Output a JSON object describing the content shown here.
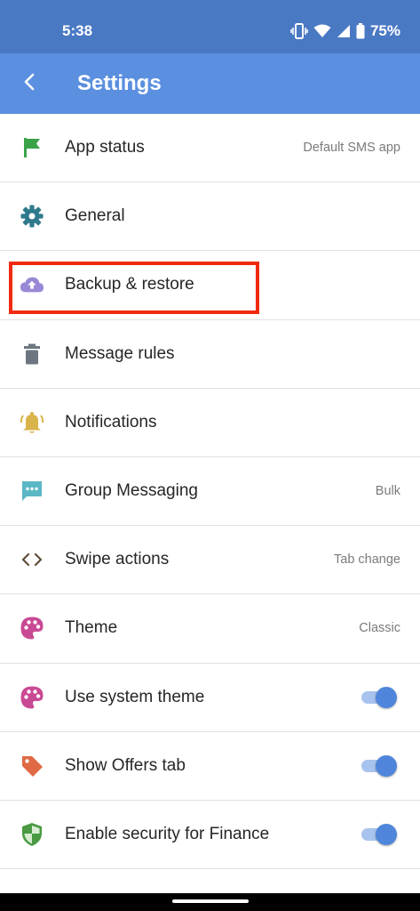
{
  "status_bar": {
    "time": "5:38",
    "battery": "75%",
    "icons": [
      "vibrate-icon",
      "wifi-icon",
      "signal-icon",
      "battery-icon"
    ]
  },
  "app_bar": {
    "title": "Settings",
    "back_icon": "chevron-left-icon"
  },
  "settings": {
    "items": [
      {
        "label": "App status",
        "value": "Default SMS app",
        "icon": "flag-icon",
        "icon_color": "#3aa34a"
      },
      {
        "label": "General",
        "value": "",
        "icon": "gear-icon",
        "icon_color": "#2e7a8c"
      },
      {
        "label": "Backup & restore",
        "value": "",
        "icon": "cloud-upload-icon",
        "icon_color": "#9a88d6"
      },
      {
        "label": "Message rules",
        "value": "",
        "icon": "trash-icon",
        "icon_color": "#6c7681"
      },
      {
        "label": "Notifications",
        "value": "",
        "icon": "bell-icon",
        "icon_color": "#d8b44a"
      },
      {
        "label": "Group Messaging",
        "value": "Bulk",
        "icon": "chat-icon",
        "icon_color": "#5bb7c4"
      },
      {
        "label": "Swipe actions",
        "value": "Tab change",
        "icon": "code-arrows-icon",
        "icon_color": "#5e4e38"
      },
      {
        "label": "Theme",
        "value": "Classic",
        "icon": "palette-icon",
        "icon_color": "#c94a94"
      },
      {
        "label": "Use system theme",
        "toggle_on": true,
        "icon": "palette-icon",
        "icon_color": "#c94a94"
      },
      {
        "label": "Show Offers tab",
        "toggle_on": true,
        "icon": "tag-icon",
        "icon_color": "#e06a45"
      },
      {
        "label": "Enable security for Finance",
        "toggle_on": true,
        "icon": "shield-icon",
        "icon_color": "#4a9a44"
      }
    ]
  },
  "highlight": {
    "target": "Backup & restore",
    "color": "#f02a10"
  },
  "colors": {
    "status_bar": "#4a79c4",
    "app_bar": "#5b8fdf",
    "toggle_thumb": "#4f86dc",
    "toggle_track": "#a8c3ee"
  }
}
